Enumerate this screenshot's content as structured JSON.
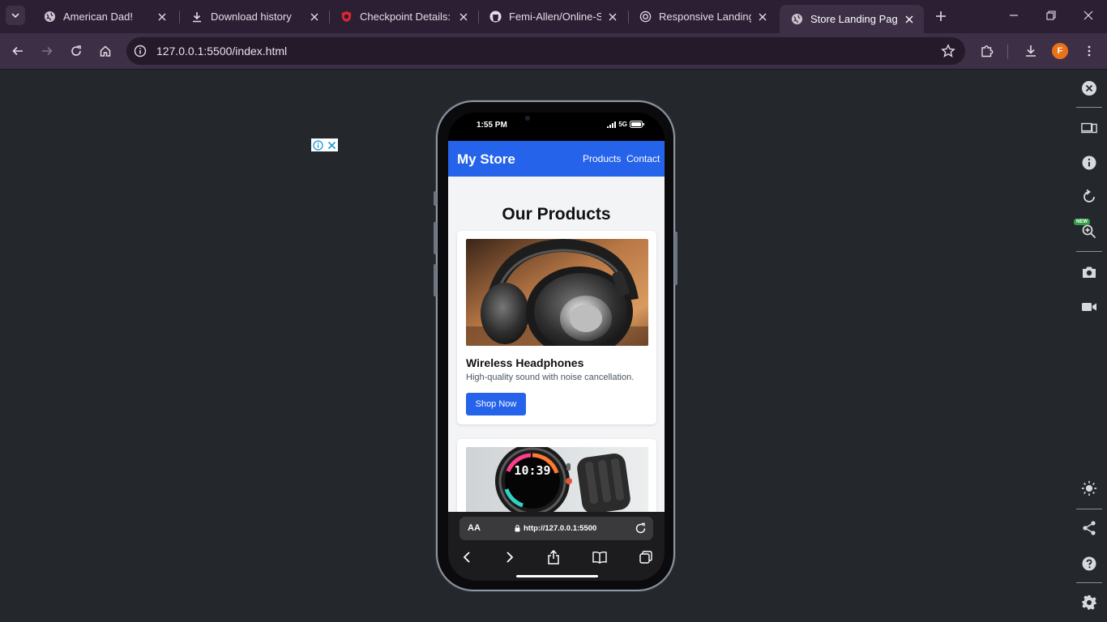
{
  "tabs": [
    {
      "title": "American Dad!",
      "icon": "globe-icon"
    },
    {
      "title": "Download history",
      "icon": "download-icon"
    },
    {
      "title": "Checkpoint Details: C",
      "icon": "shield-icon"
    },
    {
      "title": "Femi-Allen/Online-St",
      "icon": "github-icon"
    },
    {
      "title": "Responsive Landing P",
      "icon": "openai-icon"
    },
    {
      "title": "Store Landing Page",
      "icon": "globe-icon",
      "active": true
    }
  ],
  "toolbar": {
    "url": "127.0.0.1:5500/index.html",
    "profile_initial": "F"
  },
  "side_panel": {
    "new_badge": "NEW"
  },
  "phone": {
    "status_time": "1:55 PM",
    "network": "5G",
    "safari": {
      "text_size": "AA",
      "address": "http://127.0.0.1:5500"
    }
  },
  "site": {
    "brand": "My Store",
    "nav": [
      "Products",
      "Contact"
    ],
    "section_title": "Our Products",
    "products": [
      {
        "name": "Wireless Headphones",
        "description": "High-quality sound with noise cancellation.",
        "button": "Shop Now"
      },
      {
        "watch_display": "10:39"
      }
    ]
  },
  "colors": {
    "site_primary": "#2563eb",
    "browser_frame": "#3d2f45",
    "page_background": "#24272b"
  }
}
